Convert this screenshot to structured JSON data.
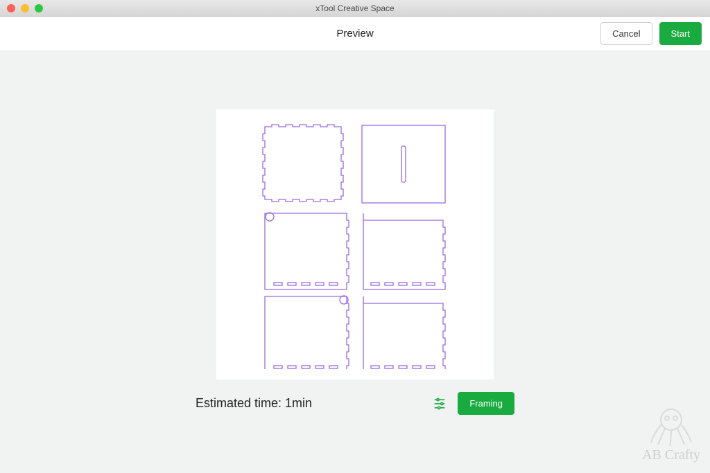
{
  "window": {
    "title": "xTool Creative Space"
  },
  "header": {
    "title": "Preview",
    "cancel_label": "Cancel",
    "start_label": "Start"
  },
  "preview": {
    "estimated_time_label": "Estimated time: 1min",
    "framing_label": "Framing"
  },
  "watermark": {
    "text": "AB Crafty"
  },
  "colors": {
    "primary": "#1aab40",
    "design_stroke": "#9b6ae0"
  }
}
